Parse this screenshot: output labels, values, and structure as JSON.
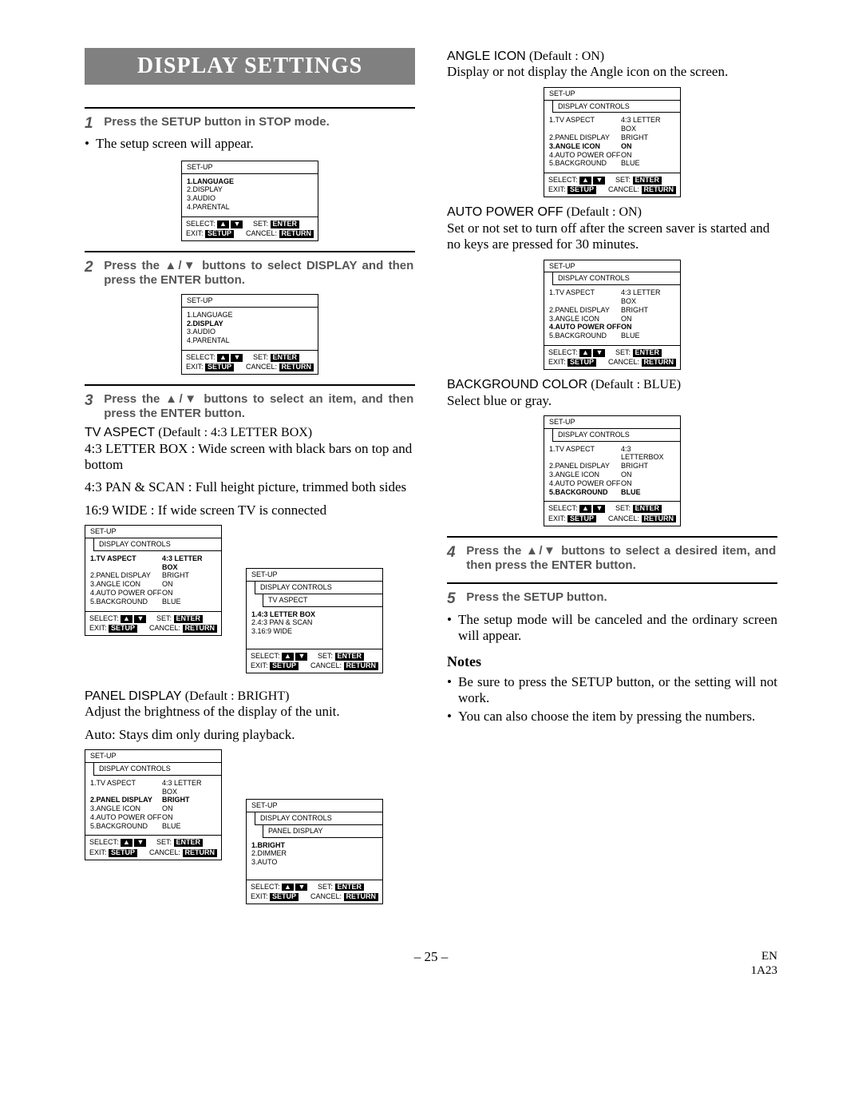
{
  "title": "DISPLAY SETTINGS",
  "steps": {
    "s1": {
      "num": "1",
      "text": "Press the SETUP button in STOP mode."
    },
    "s1_bullet": "The setup screen will appear.",
    "s2": {
      "num": "2",
      "text": "Press the ▲/▼ buttons to select DISPLAY and then press the ENTER button."
    },
    "s3": {
      "num": "3",
      "text": "Press the ▲/▼ buttons to select an item, and then press the ENTER button."
    },
    "s4": {
      "num": "4",
      "text": "Press the ▲/▼ buttons to select a desired item, and then press the ENTER button."
    },
    "s5": {
      "num": "5",
      "text": "Press the SETUP button."
    },
    "s5_bullet": "The setup mode will be canceled and the ordinary screen will appear."
  },
  "params": {
    "tv_aspect": {
      "title": "TV ASPECT",
      "default": "(Default : 4:3 LETTER BOX)",
      "lines": [
        "4:3 LETTER BOX : Wide screen with black bars on top and bottom",
        "4:3 PAN & SCAN : Full height picture, trimmed both sides",
        "16:9 WIDE : If wide screen TV is connected"
      ]
    },
    "panel_display": {
      "title": "PANEL DISPLAY",
      "default": "(Default : BRIGHT)",
      "lines": [
        "Adjust the brightness of the display of the unit.",
        "Auto: Stays dim only during playback."
      ]
    },
    "angle_icon": {
      "title": "ANGLE ICON",
      "default": "(Default : ON)",
      "lines": [
        "Display or not display the Angle icon on the screen."
      ]
    },
    "auto_power_off": {
      "title": "AUTO POWER OFF",
      "default": "(Default : ON)",
      "lines": [
        "Set or not set to turn off after the screen saver is started and no keys are pressed for 30 minutes."
      ]
    },
    "background": {
      "title": "BACKGROUND COLOR",
      "default": "(Default : BLUE)",
      "lines": [
        "Select blue or gray."
      ]
    }
  },
  "notes": {
    "heading": "Notes",
    "items": [
      "Be sure to press the SETUP button, or the setting will not work.",
      "You can also choose the item by pressing the numbers."
    ]
  },
  "osd": {
    "setup": "SET-UP",
    "display_controls": "DISPLAY CONTROLS",
    "tv_aspect_sub": "TV ASPECT",
    "panel_display_sub": "PANEL DISPLAY",
    "main_menu": {
      "i1": "1.LANGUAGE",
      "i2": "2.DISPLAY",
      "i3": "3.AUDIO",
      "i4": "4.PARENTAL"
    },
    "dc_menu": {
      "r1": {
        "lbl": "1.TV ASPECT",
        "val": "4:3 LETTER BOX"
      },
      "r2": {
        "lbl": "2.PANEL DISPLAY",
        "val": "BRIGHT"
      },
      "r3": {
        "lbl": "3.ANGLE ICON",
        "val": "ON"
      },
      "r4": {
        "lbl": "4.AUTO POWER OFF",
        "val": "ON"
      },
      "r5": {
        "lbl": "5.BACKGROUND",
        "val": "BLUE"
      }
    },
    "dc_menu_bg": {
      "r1": {
        "lbl": "1.TV ASPECT",
        "val": "4:3 LETTERBOX"
      }
    },
    "tv_aspect_list": {
      "i1": "1.4:3 LETTER BOX",
      "i2": "2.4:3 PAN & SCAN",
      "i3": "3.16:9 WIDE"
    },
    "panel_list": {
      "i1": "1.BRIGHT",
      "i2": "2.DIMMER",
      "i3": "3.AUTO"
    },
    "foot": {
      "select": "SELECT:",
      "set": "SET:",
      "enter": "ENTER",
      "exit": "EXIT:",
      "setup": "SETUP",
      "cancel": "CANCEL:",
      "return": "RETURN"
    }
  },
  "footer": {
    "page": "– 25 –",
    "lang": "EN",
    "code": "1A23"
  }
}
